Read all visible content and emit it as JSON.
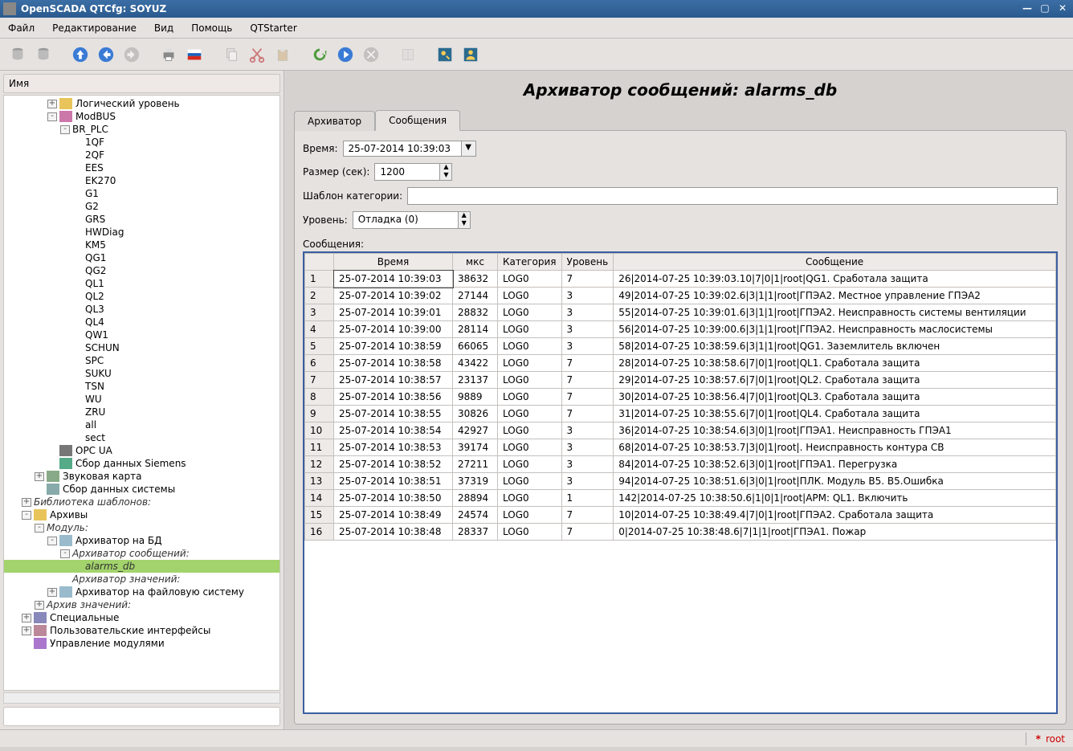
{
  "window": {
    "title": "OpenSCADA QTCfg: SOYUZ"
  },
  "menu": {
    "file": "Файл",
    "edit": "Редактирование",
    "view": "Вид",
    "help": "Помощь",
    "qtstarter": "QTStarter"
  },
  "toolbar_icons": [
    "db-gray",
    "db-gray2",
    "nav-up",
    "nav-back",
    "nav-fwd",
    "sep",
    "save",
    "flag-ru",
    "sep",
    "copy",
    "cut",
    "paste",
    "sep",
    "refresh",
    "play",
    "stop",
    "sep",
    "book",
    "sep",
    "user1",
    "user2"
  ],
  "sidebar": {
    "header": "Имя"
  },
  "tree": [
    {
      "lvl": 3,
      "tw": "+",
      "label": "Логический уровень",
      "icon": "folder-y"
    },
    {
      "lvl": 3,
      "tw": "-",
      "label": "ModBUS",
      "icon": "conn"
    },
    {
      "lvl": 4,
      "tw": "-",
      "label": "BR_PLC",
      "icon": ""
    },
    {
      "lvl": 5,
      "tw": "",
      "label": "1QF"
    },
    {
      "lvl": 5,
      "tw": "",
      "label": "2QF"
    },
    {
      "lvl": 5,
      "tw": "",
      "label": "EES"
    },
    {
      "lvl": 5,
      "tw": "",
      "label": "EK270"
    },
    {
      "lvl": 5,
      "tw": "",
      "label": "G1"
    },
    {
      "lvl": 5,
      "tw": "",
      "label": "G2"
    },
    {
      "lvl": 5,
      "tw": "",
      "label": "GRS"
    },
    {
      "lvl": 5,
      "tw": "",
      "label": "HWDiag"
    },
    {
      "lvl": 5,
      "tw": "",
      "label": "KM5"
    },
    {
      "lvl": 5,
      "tw": "",
      "label": "QG1"
    },
    {
      "lvl": 5,
      "tw": "",
      "label": "QG2"
    },
    {
      "lvl": 5,
      "tw": "",
      "label": "QL1"
    },
    {
      "lvl": 5,
      "tw": "",
      "label": "QL2"
    },
    {
      "lvl": 5,
      "tw": "",
      "label": "QL3"
    },
    {
      "lvl": 5,
      "tw": "",
      "label": "QL4"
    },
    {
      "lvl": 5,
      "tw": "",
      "label": "QW1"
    },
    {
      "lvl": 5,
      "tw": "",
      "label": "SCHUN"
    },
    {
      "lvl": 5,
      "tw": "",
      "label": "SPC"
    },
    {
      "lvl": 5,
      "tw": "",
      "label": "SUKU"
    },
    {
      "lvl": 5,
      "tw": "",
      "label": "TSN"
    },
    {
      "lvl": 5,
      "tw": "",
      "label": "WU"
    },
    {
      "lvl": 5,
      "tw": "",
      "label": "ZRU"
    },
    {
      "lvl": 5,
      "tw": "",
      "label": "all"
    },
    {
      "lvl": 5,
      "tw": "",
      "label": "sect"
    },
    {
      "lvl": 3,
      "tw": "",
      "label": "OPC UA",
      "icon": "opc"
    },
    {
      "lvl": 3,
      "tw": "",
      "label": "Сбор данных Siemens",
      "icon": "siemens"
    },
    {
      "lvl": 2,
      "tw": "+",
      "label": "Звуковая карта",
      "icon": "sound"
    },
    {
      "lvl": 2,
      "tw": "",
      "label": "Сбор данных системы",
      "icon": "sys"
    },
    {
      "lvl": 1,
      "tw": "+",
      "label": "Библиотека шаблонов:",
      "italic": true
    },
    {
      "lvl": 1,
      "tw": "-",
      "label": "Архивы",
      "icon": "archive"
    },
    {
      "lvl": 2,
      "tw": "-",
      "label": "Модуль:",
      "italic": true
    },
    {
      "lvl": 3,
      "tw": "-",
      "label": "Архиватор на БД",
      "icon": "db"
    },
    {
      "lvl": 4,
      "tw": "-",
      "label": "Архиватор сообщений:",
      "italic": true
    },
    {
      "lvl": 5,
      "tw": "",
      "label": "alarms_db",
      "sel": true,
      "italic": true
    },
    {
      "lvl": 4,
      "tw": "",
      "label": "Архиватор значений:",
      "italic": true
    },
    {
      "lvl": 3,
      "tw": "+",
      "label": "Архиватор на файловую систему",
      "icon": "fs"
    },
    {
      "lvl": 2,
      "tw": "+",
      "label": "Архив значений:",
      "italic": true
    },
    {
      "lvl": 1,
      "tw": "+",
      "label": "Специальные",
      "icon": "gear"
    },
    {
      "lvl": 1,
      "tw": "+",
      "label": "Пользовательские интерфейсы",
      "icon": "ui"
    },
    {
      "lvl": 1,
      "tw": "",
      "label": "Управление модулями",
      "icon": "mod"
    }
  ],
  "page": {
    "title": "Архиватор сообщений: alarms_db"
  },
  "tabs": [
    {
      "label": "Архиватор",
      "active": false
    },
    {
      "label": "Сообщения",
      "active": true
    }
  ],
  "form": {
    "time_label": "Время:",
    "time_value": "25-07-2014 10:39:03",
    "size_label": "Размер (сек):",
    "size_value": "1200",
    "cat_label": "Шаблон категории:",
    "cat_value": "",
    "level_label": "Уровень:",
    "level_value": "Отладка (0)",
    "messages_label": "Сообщения:"
  },
  "table": {
    "headers": [
      "",
      "Время",
      "мкс",
      "Категория",
      "Уровень",
      "Сообщение"
    ],
    "rows": [
      {
        "n": "1",
        "time": "25-07-2014 10:39:03",
        "mcs": "38632",
        "cat": "LOG0",
        "lvl": "7",
        "msg": "26|2014-07-25 10:39:03.10|7|0|1|root|QG1. Сработала защита",
        "sel": true
      },
      {
        "n": "2",
        "time": "25-07-2014 10:39:02",
        "mcs": "27144",
        "cat": "LOG0",
        "lvl": "3",
        "msg": "49|2014-07-25 10:39:02.6|3|1|1|root|ГПЭА2. Местное управление ГПЭА2"
      },
      {
        "n": "3",
        "time": "25-07-2014 10:39:01",
        "mcs": "28832",
        "cat": "LOG0",
        "lvl": "3",
        "msg": "55|2014-07-25 10:39:01.6|3|1|1|root|ГПЭА2. Неисправность системы вентиляции"
      },
      {
        "n": "4",
        "time": "25-07-2014 10:39:00",
        "mcs": "28114",
        "cat": "LOG0",
        "lvl": "3",
        "msg": "56|2014-07-25 10:39:00.6|3|1|1|root|ГПЭА2. Неисправность маслосистемы"
      },
      {
        "n": "5",
        "time": "25-07-2014 10:38:59",
        "mcs": "66065",
        "cat": "LOG0",
        "lvl": "3",
        "msg": "58|2014-07-25 10:38:59.6|3|1|1|root|QG1. Заземлитель включен"
      },
      {
        "n": "6",
        "time": "25-07-2014 10:38:58",
        "mcs": "43422",
        "cat": "LOG0",
        "lvl": "7",
        "msg": "28|2014-07-25 10:38:58.6|7|0|1|root|QL1. Сработала защита"
      },
      {
        "n": "7",
        "time": "25-07-2014 10:38:57",
        "mcs": "23137",
        "cat": "LOG0",
        "lvl": "7",
        "msg": "29|2014-07-25 10:38:57.6|7|0|1|root|QL2. Сработала защита"
      },
      {
        "n": "8",
        "time": "25-07-2014 10:38:56",
        "mcs": "9889",
        "cat": "LOG0",
        "lvl": "7",
        "msg": "30|2014-07-25 10:38:56.4|7|0|1|root|QL3. Сработала защита"
      },
      {
        "n": "9",
        "time": "25-07-2014 10:38:55",
        "mcs": "30826",
        "cat": "LOG0",
        "lvl": "7",
        "msg": "31|2014-07-25 10:38:55.6|7|0|1|root|QL4. Сработала защита"
      },
      {
        "n": "10",
        "time": "25-07-2014 10:38:54",
        "mcs": "42927",
        "cat": "LOG0",
        "lvl": "3",
        "msg": "36|2014-07-25 10:38:54.6|3|0|1|root|ГПЭА1. Неисправность ГПЭА1"
      },
      {
        "n": "11",
        "time": "25-07-2014 10:38:53",
        "mcs": "39174",
        "cat": "LOG0",
        "lvl": "3",
        "msg": "68|2014-07-25 10:38:53.7|3|0|1|root|. Неисправность контура СВ"
      },
      {
        "n": "12",
        "time": "25-07-2014 10:38:52",
        "mcs": "27211",
        "cat": "LOG0",
        "lvl": "3",
        "msg": "84|2014-07-25 10:38:52.6|3|0|1|root|ГПЭА1. Перегрузка"
      },
      {
        "n": "13",
        "time": "25-07-2014 10:38:51",
        "mcs": "37319",
        "cat": "LOG0",
        "lvl": "3",
        "msg": "94|2014-07-25 10:38:51.6|3|0|1|root|ПЛК. Модуль B5. B5.Ошибка"
      },
      {
        "n": "14",
        "time": "25-07-2014 10:38:50",
        "mcs": "28894",
        "cat": "LOG0",
        "lvl": "1",
        "msg": "142|2014-07-25 10:38:50.6|1|0|1|root|АРМ: QL1. Включить"
      },
      {
        "n": "15",
        "time": "25-07-2014 10:38:49",
        "mcs": "24574",
        "cat": "LOG0",
        "lvl": "7",
        "msg": "10|2014-07-25 10:38:49.4|7|0|1|root|ГПЭА2. Сработала защита"
      },
      {
        "n": "16",
        "time": "25-07-2014 10:38:48",
        "mcs": "28337",
        "cat": "LOG0",
        "lvl": "7",
        "msg": "0|2014-07-25 10:38:48.6|7|1|1|root|ГПЭА1. Пожар"
      }
    ]
  },
  "status": {
    "asterisk": "*",
    "user": "root"
  }
}
